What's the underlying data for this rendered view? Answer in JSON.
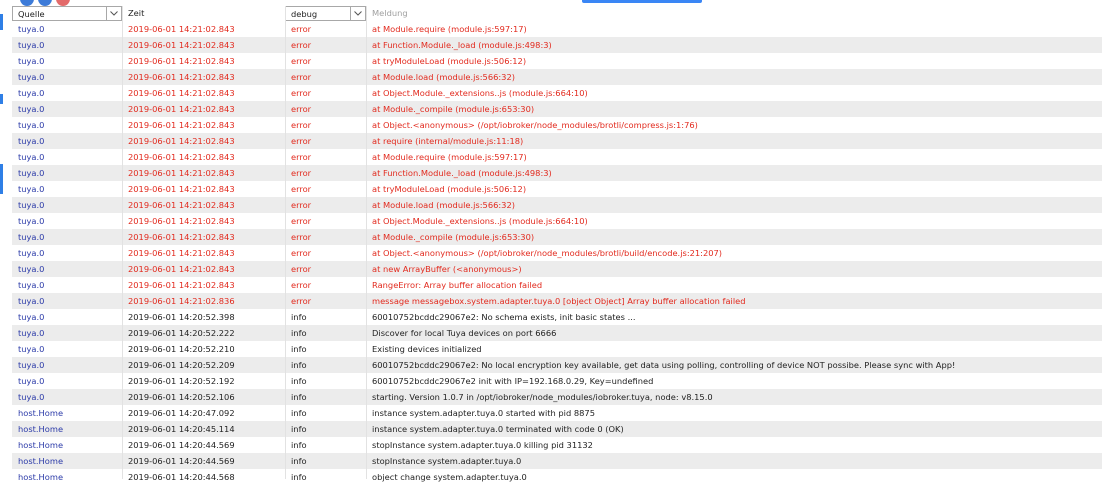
{
  "columns": {
    "source": "Quelle",
    "time": "Zeit",
    "severity": "debug",
    "message_placeholder": "Meldung"
  },
  "rows": [
    {
      "src": "tuya.0",
      "time": "2019-06-01 14:21:02.843",
      "sev": "error",
      "msg": "at Module.require (module.js:597:17)"
    },
    {
      "src": "tuya.0",
      "time": "2019-06-01 14:21:02.843",
      "sev": "error",
      "msg": "at Function.Module._load (module.js:498:3)"
    },
    {
      "src": "tuya.0",
      "time": "2019-06-01 14:21:02.843",
      "sev": "error",
      "msg": "at tryModuleLoad (module.js:506:12)"
    },
    {
      "src": "tuya.0",
      "time": "2019-06-01 14:21:02.843",
      "sev": "error",
      "msg": "at Module.load (module.js:566:32)"
    },
    {
      "src": "tuya.0",
      "time": "2019-06-01 14:21:02.843",
      "sev": "error",
      "msg": "at Object.Module._extensions..js (module.js:664:10)"
    },
    {
      "src": "tuya.0",
      "time": "2019-06-01 14:21:02.843",
      "sev": "error",
      "msg": "at Module._compile (module.js:653:30)"
    },
    {
      "src": "tuya.0",
      "time": "2019-06-01 14:21:02.843",
      "sev": "error",
      "msg": "at Object.<anonymous> (/opt/iobroker/node_modules/brotli/compress.js:1:76)"
    },
    {
      "src": "tuya.0",
      "time": "2019-06-01 14:21:02.843",
      "sev": "error",
      "msg": "at require (internal/module.js:11:18)"
    },
    {
      "src": "tuya.0",
      "time": "2019-06-01 14:21:02.843",
      "sev": "error",
      "msg": "at Module.require (module.js:597:17)"
    },
    {
      "src": "tuya.0",
      "time": "2019-06-01 14:21:02.843",
      "sev": "error",
      "msg": "at Function.Module._load (module.js:498:3)"
    },
    {
      "src": "tuya.0",
      "time": "2019-06-01 14:21:02.843",
      "sev": "error",
      "msg": "at tryModuleLoad (module.js:506:12)"
    },
    {
      "src": "tuya.0",
      "time": "2019-06-01 14:21:02.843",
      "sev": "error",
      "msg": "at Module.load (module.js:566:32)"
    },
    {
      "src": "tuya.0",
      "time": "2019-06-01 14:21:02.843",
      "sev": "error",
      "msg": "at Object.Module._extensions..js (module.js:664:10)"
    },
    {
      "src": "tuya.0",
      "time": "2019-06-01 14:21:02.843",
      "sev": "error",
      "msg": "at Module._compile (module.js:653:30)"
    },
    {
      "src": "tuya.0",
      "time": "2019-06-01 14:21:02.843",
      "sev": "error",
      "msg": "at Object.<anonymous> (/opt/iobroker/node_modules/brotli/build/encode.js:21:207)"
    },
    {
      "src": "tuya.0",
      "time": "2019-06-01 14:21:02.843",
      "sev": "error",
      "msg": "at new ArrayBuffer (<anonymous>)"
    },
    {
      "src": "tuya.0",
      "time": "2019-06-01 14:21:02.843",
      "sev": "error",
      "msg": "RangeError: Array buffer allocation failed"
    },
    {
      "src": "tuya.0",
      "time": "2019-06-01 14:21:02.836",
      "sev": "error",
      "msg": "message messagebox.system.adapter.tuya.0 [object Object] Array buffer allocation failed"
    },
    {
      "src": "tuya.0",
      "time": "2019-06-01 14:20:52.398",
      "sev": "info",
      "msg": "60010752bcddc29067e2: No schema exists, init basic states ..."
    },
    {
      "src": "tuya.0",
      "time": "2019-06-01 14:20:52.222",
      "sev": "info",
      "msg": "Discover for local Tuya devices on port 6666"
    },
    {
      "src": "tuya.0",
      "time": "2019-06-01 14:20:52.210",
      "sev": "info",
      "msg": "Existing devices initialized"
    },
    {
      "src": "tuya.0",
      "time": "2019-06-01 14:20:52.209",
      "sev": "info",
      "msg": "60010752bcddc29067e2: No local encryption key available, get data using polling, controlling of device NOT possibe. Please sync with App!"
    },
    {
      "src": "tuya.0",
      "time": "2019-06-01 14:20:52.192",
      "sev": "info",
      "msg": "60010752bcddc29067e2 init with IP=192.168.0.29, Key=undefined"
    },
    {
      "src": "tuya.0",
      "time": "2019-06-01 14:20:52.106",
      "sev": "info",
      "msg": "starting. Version 1.0.7 in /opt/iobroker/node_modules/iobroker.tuya, node: v8.15.0"
    },
    {
      "src": "host.Home",
      "time": "2019-06-01 14:20:47.092",
      "sev": "info",
      "msg": "instance system.adapter.tuya.0 started with pid 8875"
    },
    {
      "src": "host.Home",
      "time": "2019-06-01 14:20:45.114",
      "sev": "info",
      "msg": "instance system.adapter.tuya.0 terminated with code 0 (OK)"
    },
    {
      "src": "host.Home",
      "time": "2019-06-01 14:20:44.569",
      "sev": "info",
      "msg": "stopInstance system.adapter.tuya.0 killing pid 31132"
    },
    {
      "src": "host.Home",
      "time": "2019-06-01 14:20:44.569",
      "sev": "info",
      "msg": "stopInstance system.adapter.tuya.0"
    },
    {
      "src": "host.Home",
      "time": "2019-06-01 14:20:44.568",
      "sev": "info",
      "msg": "object change system.adapter.tuya.0"
    }
  ],
  "colors": {
    "source_text": "#2b3aa8",
    "error_text": "#e22a1e",
    "info_text": "#222222",
    "stripe": "#ececec",
    "accent": "#3a86f5"
  },
  "icons": {
    "dropdown": "chevron-down-icon"
  }
}
